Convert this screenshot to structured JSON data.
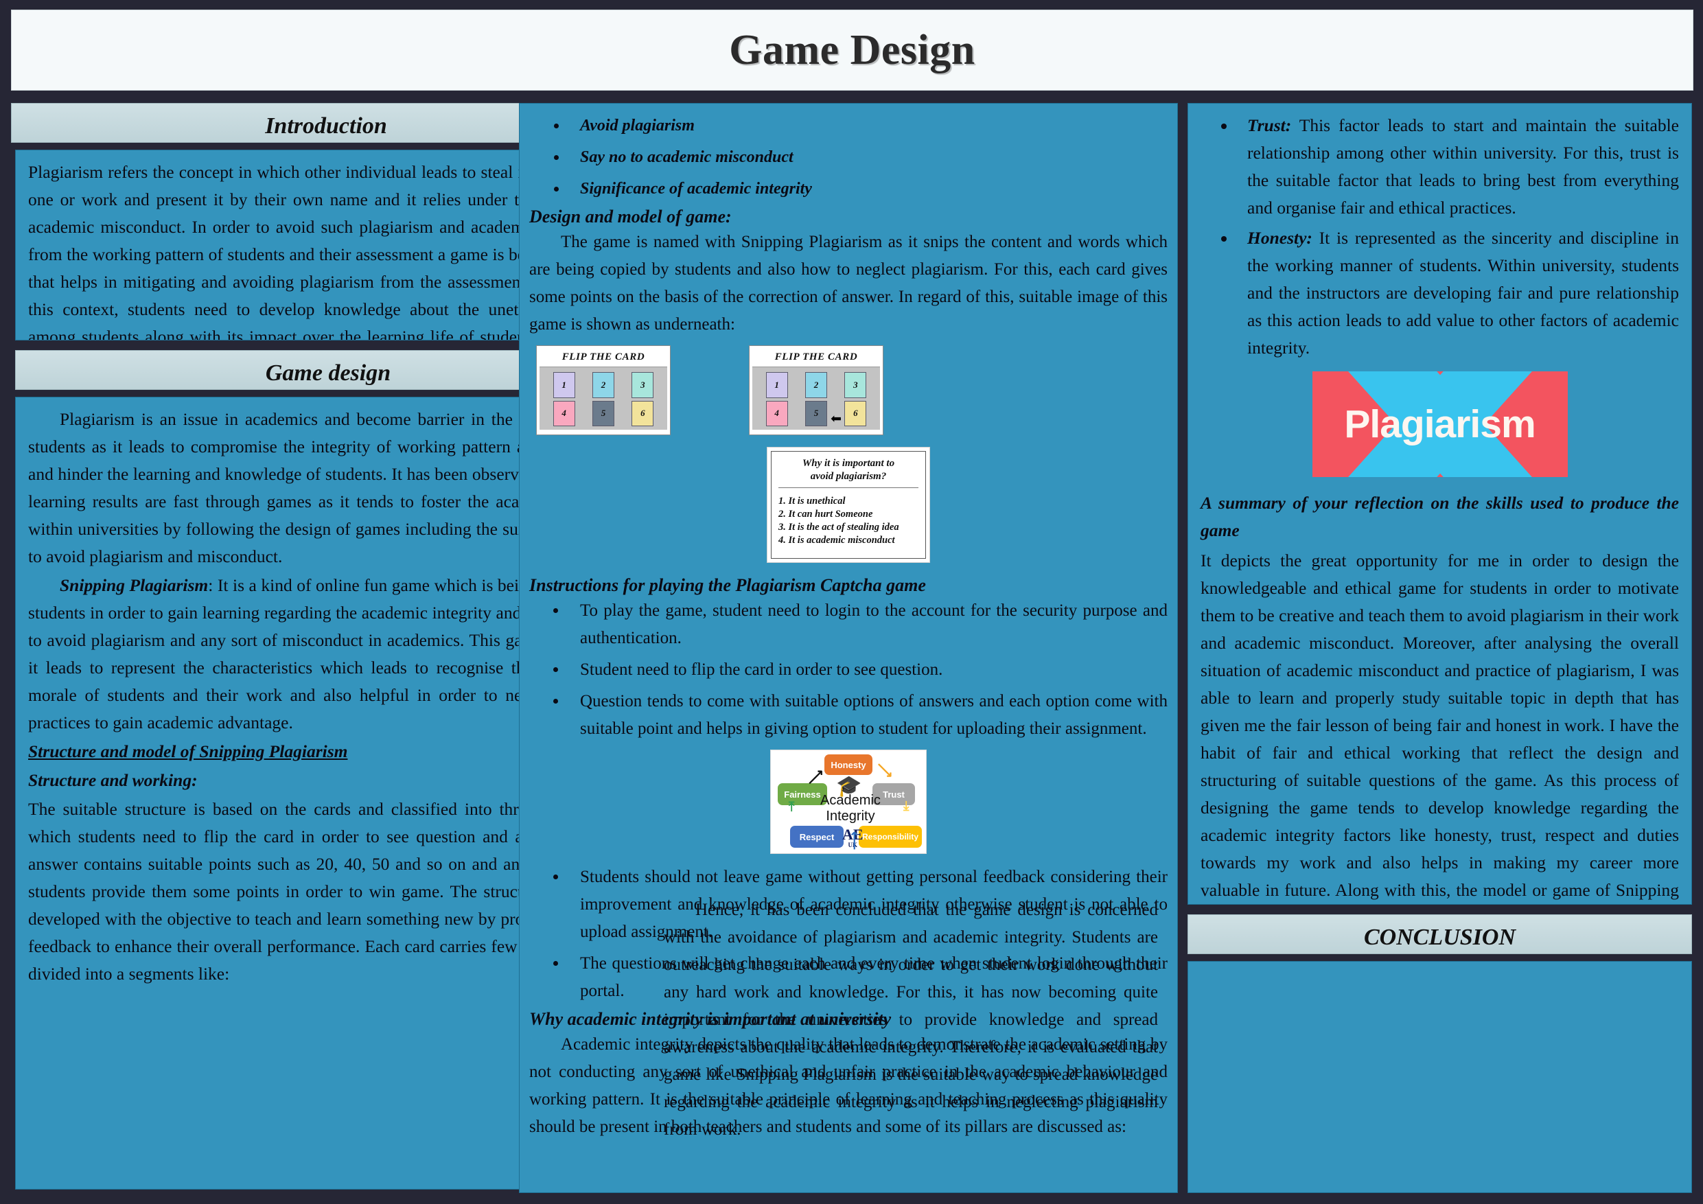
{
  "poster": {
    "title": "Game Design"
  },
  "left": {
    "intro": {
      "heading": "Introduction",
      "paragraph": "Plagiarism refers the concept in which other individual leads to steal idea of another one or work and present it by their own name and it relies under the category of academic misconduct. In order to avoid such plagiarism and academic misconduct from the working pattern of students and their assessment a game is being developed that helps in mitigating and avoiding plagiarism from the assessment of people. In this context, students need to develop knowledge about the unethical practices among students along with its impact over the learning life of students. Hence, the game is being designed in order to develop the overall knowledge of academic integrity and also neglecting plagiarism. It leads to outline the significance of academic integrity among students which is useful to"
    },
    "game_design": {
      "heading": "Game design",
      "p1": "Plagiarism is an issue in academics and become barrier in the learning life of students as it leads to compromise the integrity of working pattern among students and hinder the learning and knowledge of students. It has been observed that students learning results are fast through games as it tends to foster the academic integrity within universities by following the design of games including the suitable strategies to avoid plagiarism and misconduct.",
      "p2_label": "Snipping Plagiarism",
      "p2": ": It is a kind of online fun game which is being designed for students in order to gain learning regarding the academic integrity and also help them to avoid plagiarism and any sort of misconduct in academics. This game is useful as it leads to represent the characteristics which leads to recognise the honesty and morale of students and their work and also helpful in order to neglect unethical practices to gain academic advantage.",
      "sub1": "Structure and model of Snipping Plagiarism",
      "sub2": "Structure and working:",
      "p3": "The suitable structure is based on the cards and classified into three segments in which students need to flip the card in order to see question and answer it. Each answer contains suitable points such as 20, 40, 50 and so on and answers given by students provide them some points in order to win game. The structure of game is developed with the objective to teach and learn something new by providing suitable feedback to enhance their overall performance. Each card carries few points and also divided into a segments like:"
    }
  },
  "middle": {
    "top_bullets": [
      "Avoid plagiarism",
      "Say no to academic misconduct",
      "Significance of academic integrity"
    ],
    "design_heading": "Design and model of game:",
    "design_paragraph": "The game is named with Snipping Plagiarism as it snips the content and words which are being copied by students and also how to neglect plagiarism. For this, each card gives some points on the basis of the correction of answer. In regard of this, suitable image of this game is shown as underneath:",
    "flip_card": {
      "title": "FLIP THE CARD",
      "numbers": [
        "1",
        "2",
        "3",
        "4",
        "5",
        "6"
      ],
      "colors": [
        "#cfc8ee",
        "#8ed6e8",
        "#a8e6dc",
        "#f9a8bf",
        "#6b7b8c",
        "#f2e39b"
      ],
      "pointer_icon": "left-arrow-icon"
    },
    "why_box": {
      "title_line1": "Why it is important to",
      "title_line2": "avoid plagiarism?",
      "items": [
        "1. It is unethical",
        "2. It can hurt Someone",
        "3. It is the act of stealing idea",
        "4. It is academic misconduct"
      ]
    },
    "instructions_heading": "Instructions for playing the Plagiarism Captcha game",
    "instructions": [
      "To play the game, student need to login to the account for the security purpose and authentication.",
      "Student need to flip the card in order to see question.",
      "Question tends to come with suitable options of answers and each option come with suitable point and helps in giving option to student for uploading their assignment."
    ],
    "ai_diagram": {
      "center_line1": "Academic",
      "center_line2": "Integrity",
      "honesty": "Honesty",
      "fairness": "Fairness",
      "trust": "Trust",
      "respect": "Respect",
      "responsibility": "Responsibility",
      "logo": "AE",
      "logo_sub": "UK",
      "cap_icon": "graduation-cap-icon"
    },
    "instructions2": [
      "Students should not leave game without getting personal feedback considering their improvement and knowledge of academic integrity otherwise student is not able to upload assignment.",
      "The questions will get change each and every time when student login through their portal."
    ],
    "why_heading": "Why academic integrity is important at university",
    "why_p1": "Academic integrity depicts the quality that leads to demonstrate the academic setting by not conducting any sort of unethical and unfair practice in the academic behaviour and working pattern. It is the suitable principle of learning and teaching process as this quality should be present in both teachers and students and some of its pillars are discussed as:",
    "overlap_p1": "Hence, it has been concluded that the game design is concerned with the avoidance of plagiarism and academic integrity. Students are outreaching the suitable ways in order to get their work done without any hard work and knowledge. For this, it has now becoming quite important for the universities to provide knowledge and spread awareness about the academic integrity. Therefore, it is evaluated that game like Snipping Plagiarism is the suitable way to spread knowledge regarding the academic integrity as it helps in neglecting plagiarism from work."
  },
  "right": {
    "bullets": [
      {
        "label": "Trust:",
        "text": " This factor leads to start and maintain the suitable relationship among other within university. For this, trust is the suitable factor that leads to bring best from everything and organise fair and ethical practices."
      },
      {
        "label": "Honesty:",
        "text": " It is represented as the sincerity and discipline in the working manner of students. Within university, students and the instructors are developing fair and pure relationship as this action leads to add value to other factors of academic integrity."
      }
    ],
    "banner_text": "Plagiarism",
    "reflection_heading": "A summary of your reflection on the skills used to produce the game",
    "reflection_text": "It depicts the great opportunity for me in order to design the knowledgeable and ethical game for students in order to motivate them to be creative and teach them to avoid plagiarism in their work and academic misconduct. Moreover, after analysing the overall situation of academic misconduct and practice of plagiarism, I was able to learn and properly study suitable topic in depth that has given me the fair lesson of being fair and honest in work. I have the habit of fair and ethical working that reflect the design and structuring of suitable questions of the game. As this process of designing the game tends to develop knowledge regarding the academic integrity factors like honesty, trust, respect and duties towards my work and also helps in making my career more valuable in future. Along with this, the model or game of Snipping Plagiarism leads to reflect my overall experience and knowledge which is useful for students to neglect academic misconduct like plagiarism and work with integrity in order to become successful to attract others with trust and honesty.",
    "conclusion_heading": "CONCLUSION",
    "conclusion_text": ""
  },
  "colors": {
    "background": "#262635",
    "panel": "#3494bd",
    "header": "#cfe0e4",
    "banner": "#f5f9fa",
    "plagiarism_red": "#f3545f",
    "plagiarism_blue": "#39c4ee"
  }
}
